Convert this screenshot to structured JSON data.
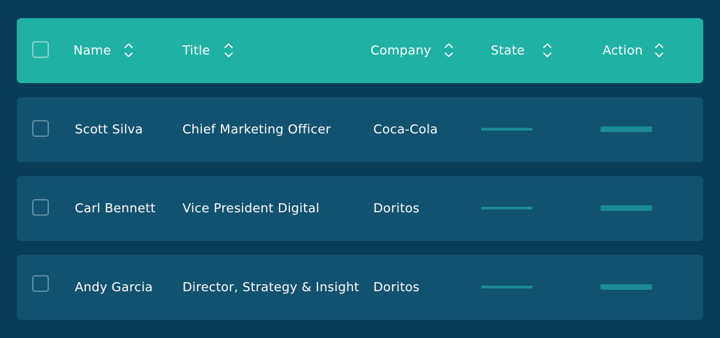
{
  "colors": {
    "background": "#083d58",
    "header_bg": "#20b1a5",
    "row_bg": "#11526e",
    "placeholder_bar": "#1e8a93",
    "text": "#ffffff"
  },
  "header": {
    "select_all_checked": false,
    "columns": [
      {
        "key": "name",
        "label": "Name",
        "icon": "sort-icon"
      },
      {
        "key": "title",
        "label": "Title",
        "icon": "sort-icon"
      },
      {
        "key": "company",
        "label": "Company",
        "icon": "sort-icon"
      },
      {
        "key": "state",
        "label": "State",
        "icon": "sort-icon"
      },
      {
        "key": "action",
        "label": "Action",
        "icon": "sort-icon"
      }
    ]
  },
  "rows": [
    {
      "checked": false,
      "name": "Scott Silva",
      "title": "Chief Marketing Officer",
      "company": "Coca-Cola"
    },
    {
      "checked": false,
      "name": "Carl Bennett",
      "title": "Vice President Digital",
      "company": "Doritos"
    },
    {
      "checked": false,
      "name": "Andy Garcia",
      "title": "Director, Strategy & Insight",
      "company": "Doritos"
    }
  ]
}
